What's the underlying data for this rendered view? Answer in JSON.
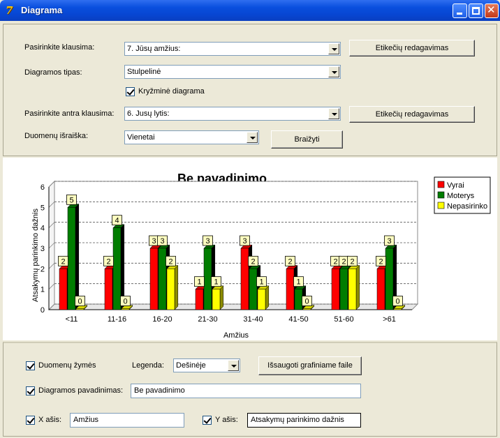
{
  "window": {
    "title": "Diagrama"
  },
  "top": {
    "q1_label": "Pasirinkite klausima:",
    "q1_value": "7. Jūsų amžius:",
    "edit_labels_1": "Etikečių redagavimas",
    "type_label": "Diagramos tipas:",
    "type_value": "Stulpelinė",
    "cross_label": "Kryžminė diagrama",
    "q2_label": "Pasirinkite antra klausima:",
    "q2_value": "6. Jusų lytis:",
    "edit_labels_2": "Etikečių redagavimas",
    "data_label": "Duomenų išraiška:",
    "data_value": "Vienetai",
    "draw_button": "Braižyti"
  },
  "bottom": {
    "data_marks_label": "Duomenų žymės",
    "legend_label": "Legenda:",
    "legend_value": "Dešinėje",
    "save_button": "Išsaugoti grafiniame faile",
    "title_chk_label": "Diagramos pavadinimas:",
    "title_value": "Be pavadinimo",
    "x_chk_label": "X ašis:",
    "x_value": "Amžius",
    "y_chk_label": "Y ašis:",
    "y_value": "Atsakymų parinkimo dažnis"
  },
  "colors": {
    "series": [
      "#ff0000",
      "#007d00",
      "#ffff00"
    ]
  },
  "chart_data": {
    "type": "bar",
    "title": "Be pavadinimo",
    "xlabel": "Amžius",
    "ylabel": "Atsakymų parinkimo dažnis",
    "ylim": [
      0,
      6
    ],
    "yticks": [
      "0",
      "1",
      "2",
      "3",
      "4",
      "5",
      "6"
    ],
    "grid": true,
    "legend": "right",
    "categories": [
      "<11",
      "11-16",
      "16-20",
      "21-30",
      "31-40",
      "41-50",
      "51-60",
      ">61"
    ],
    "series": [
      {
        "name": "Vyrai",
        "values": [
          2,
          2,
          3,
          1,
          3,
          2,
          2,
          2
        ]
      },
      {
        "name": "Moterys",
        "values": [
          5,
          4,
          3,
          3,
          2,
          1,
          2,
          3
        ]
      },
      {
        "name": "Nepasirinko",
        "values": [
          0,
          0,
          2,
          1,
          1,
          0,
          2,
          0
        ]
      }
    ]
  }
}
